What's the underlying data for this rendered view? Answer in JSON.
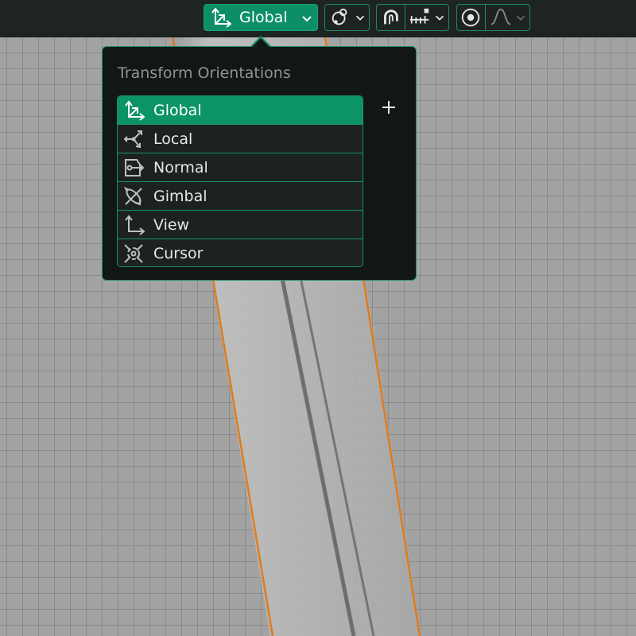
{
  "header": {
    "orientation_button": {
      "label": "Global",
      "icon": "axes-global-icon"
    },
    "pivot_button": {
      "icon": "pivot-point-icon"
    },
    "snap_button": {
      "icon": "snap-magnet-icon",
      "target_icon": "snap-increment-icon"
    },
    "proportional_button": {
      "icon": "proportional-editing-icon",
      "falloff_icon": "falloff-curve-icon"
    }
  },
  "popup": {
    "title": "Transform Orientations",
    "add_label": "+",
    "items": [
      {
        "label": "Global",
        "icon": "axes-global-icon",
        "selected": true
      },
      {
        "label": "Local",
        "icon": "local-orientation-icon",
        "selected": false
      },
      {
        "label": "Normal",
        "icon": "normal-orientation-icon",
        "selected": false
      },
      {
        "label": "Gimbal",
        "icon": "gimbal-orientation-icon",
        "selected": false
      },
      {
        "label": "View",
        "icon": "view-orientation-icon",
        "selected": false
      },
      {
        "label": "Cursor",
        "icon": "cursor-orientation-icon",
        "selected": false
      }
    ]
  },
  "colors": {
    "accent": "#0c9467",
    "border": "#1a8f63",
    "panel": "#121716",
    "selection_outline": "#e07b1e"
  }
}
